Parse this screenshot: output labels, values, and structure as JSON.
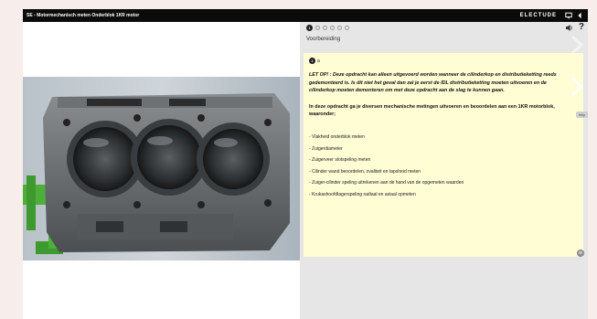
{
  "header": {
    "title": "SE - Motormechanisch meten Onderblok 1KR motor",
    "brand": "ELECTUDE"
  },
  "progress": {
    "current_step": "1",
    "total_dots": 6
  },
  "panel": {
    "section_title": "Voorbereiding",
    "step_number": "1",
    "step_label": "a",
    "warning": "LET OP! : Deze opdracht kan alleen uitgevoerd worden wanneer de cilinderkop en distributieketting reeds gedemonteerd is. Is dit niet het geval dan zal je eerst de IDL distributieketting moeten uitvoeren en de cilinderkop moeten demonteren om met deze opdracht aan de slag te kunnen gaan.",
    "intro": "In deze opdracht ga je diversen mechanische metingen uitvoeren en beoordelen aan een 1KR motorblok, waaronder;",
    "items": [
      "- Vlakheid onderblok meten",
      "- Zuigerdiameter",
      "- Zuigerveer slotspeling meten",
      "- Cilinder wand beoordelen, ovaliteit en tapsheid meten",
      "- Zuiger-cilinder speling uitrekenen aan de hand van de opgemeten waarden",
      "- Krukashoofdlagerspeling radiaal en axiaal opmeten"
    ],
    "side_tab": "Help"
  },
  "icons": {
    "speaker": "speaker-icon",
    "help": "help-icon",
    "screen": "screen-icon",
    "back": "back-icon"
  },
  "colors": {
    "topbar": "#0b0b0b",
    "card": "#fffdd4",
    "panel": "#e6e6e6",
    "engine_stand": "#4caf3a"
  }
}
